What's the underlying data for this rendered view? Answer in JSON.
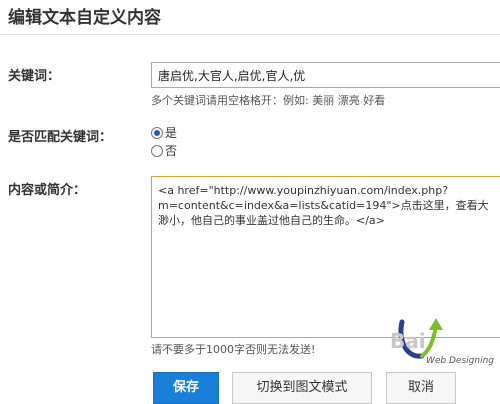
{
  "header": {
    "title": "编辑文本自定义内容"
  },
  "keyword": {
    "label": "关键词：",
    "value": "唐启优,大官人,启优,官人,优",
    "hint": "多个关键词请用空格格开：例如: 美丽 漂亮 好看"
  },
  "match": {
    "label": "是否匹配关键词：",
    "options": [
      "是",
      "否"
    ],
    "selected": "是"
  },
  "content": {
    "label": "内容或简介：",
    "text": "<a href=\"http://www.youpinzhiyuan.com/index.php?\nm=content&c=index&a=lists&catid=194\">点击这里，查看大\n渺小，他自己的事业盖过他自己的生命。</a>",
    "hint": "请不要多于1000字否则无法发送!"
  },
  "buttons": {
    "save": "保存",
    "switch": "切换到图文模式",
    "cancel": "取消"
  },
  "watermark": {
    "logo_text": "Bai",
    "caption": "Web Designing"
  }
}
